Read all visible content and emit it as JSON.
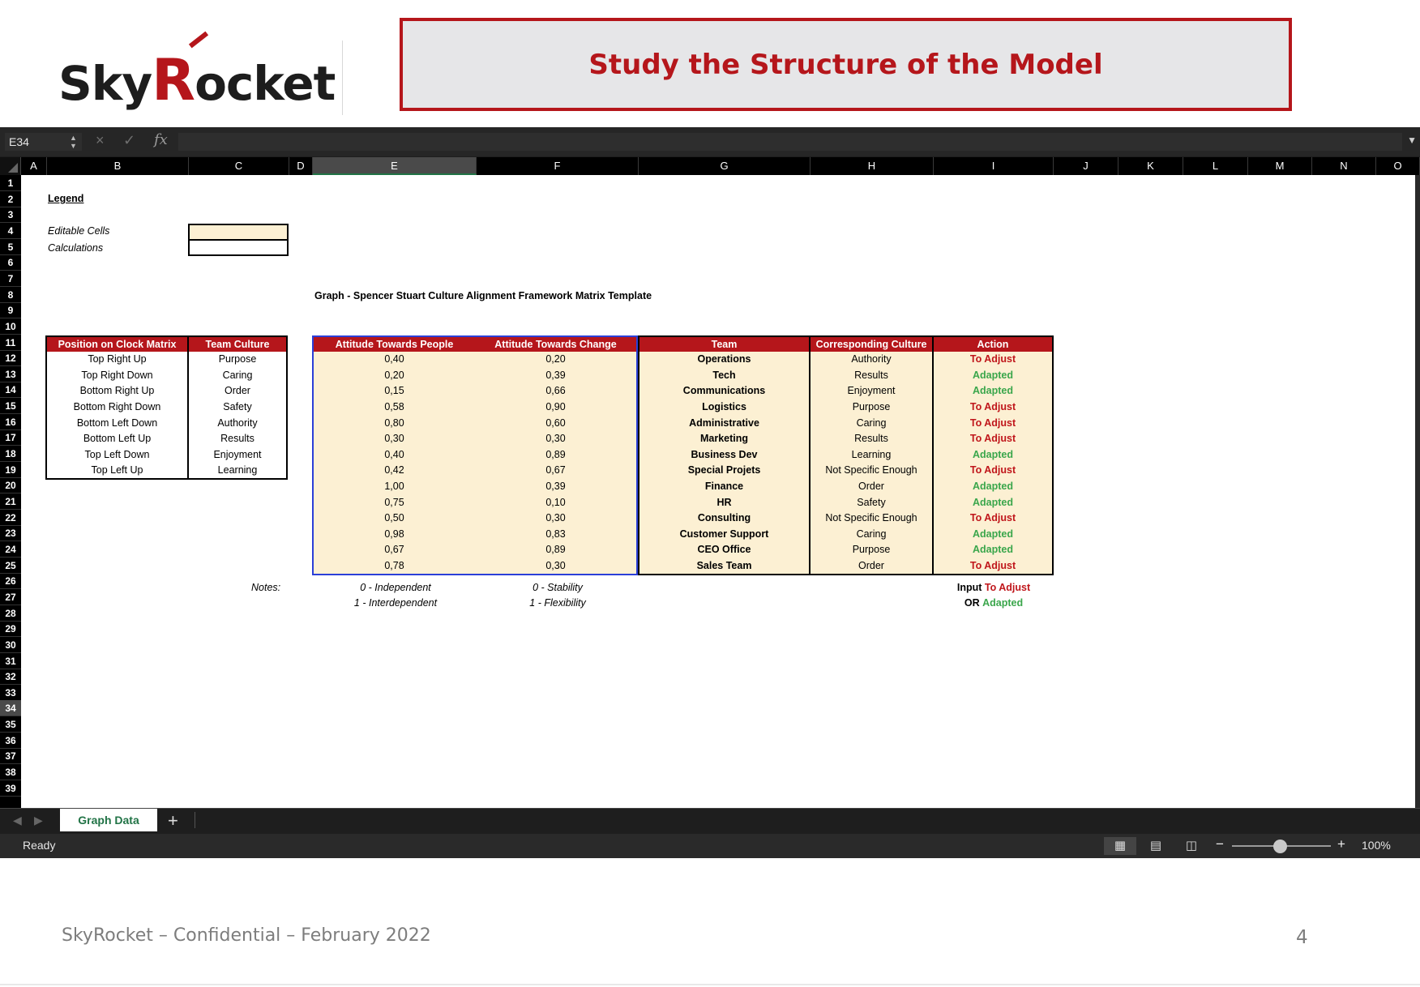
{
  "slide": {
    "logo": "SkyRocket",
    "title": "Study the Structure of the Model",
    "footer": "SkyRocket – Confidential – February 2022",
    "page_number": "4"
  },
  "formula_bar": {
    "name_box": "E34",
    "cancel_icon": "×",
    "confirm_icon": "✓",
    "fx_label": "fx",
    "value": ""
  },
  "columns": [
    "A",
    "B",
    "C",
    "D",
    "E",
    "F",
    "G",
    "H",
    "I",
    "J",
    "K",
    "L",
    "M",
    "N",
    "O"
  ],
  "selected_column": "E",
  "rows": [
    "1",
    "2",
    "3",
    "4",
    "5",
    "6",
    "7",
    "8",
    "9",
    "10",
    "11",
    "12",
    "13",
    "14",
    "15",
    "16",
    "17",
    "18",
    "19",
    "20",
    "21",
    "22",
    "23",
    "24",
    "25",
    "26",
    "27",
    "28",
    "29",
    "30",
    "31",
    "32",
    "33",
    "34",
    "35",
    "36",
    "37",
    "38",
    "39"
  ],
  "selected_row": "34",
  "legend": {
    "title": "Legend",
    "editable_label": "Editable Cells",
    "calculations_label": "Calculations",
    "editable_color": "#fcf0d3"
  },
  "graph_title": "Graph - Spencer Stuart Culture Alignment Framework Matrix Template",
  "clock_table": {
    "headers": [
      "Position on Clock Matrix",
      "Team Culture"
    ],
    "rows": [
      [
        "Top Right Up",
        "Purpose"
      ],
      [
        "Top Right Down",
        "Caring"
      ],
      [
        "Bottom Right Up",
        "Order"
      ],
      [
        "Bottom Right Down",
        "Safety"
      ],
      [
        "Bottom Left Down",
        "Authority"
      ],
      [
        "Bottom Left Up",
        "Results"
      ],
      [
        "Top Left Down",
        "Enjoyment"
      ],
      [
        "Top Left Up",
        "Learning"
      ]
    ]
  },
  "data_table": {
    "headers": [
      "Attitude Towards People",
      "Attitude Towards Change",
      "Team",
      "Corresponding Culture",
      "Action"
    ],
    "rows": [
      [
        "0,40",
        "0,20",
        "Operations",
        "Authority",
        "To Adjust"
      ],
      [
        "0,20",
        "0,39",
        "Tech",
        "Results",
        "Adapted"
      ],
      [
        "0,15",
        "0,66",
        "Communications",
        "Enjoyment",
        "Adapted"
      ],
      [
        "0,58",
        "0,90",
        "Logistics",
        "Purpose",
        "To Adjust"
      ],
      [
        "0,80",
        "0,60",
        "Administrative",
        "Caring",
        "To Adjust"
      ],
      [
        "0,30",
        "0,30",
        "Marketing",
        "Results",
        "To Adjust"
      ],
      [
        "0,40",
        "0,89",
        "Business Dev",
        "Learning",
        "Adapted"
      ],
      [
        "0,42",
        "0,67",
        "Special Projets",
        "Not Specific Enough",
        "To Adjust"
      ],
      [
        "1,00",
        "0,39",
        "Finance",
        "Order",
        "Adapted"
      ],
      [
        "0,75",
        "0,10",
        "HR",
        "Safety",
        "Adapted"
      ],
      [
        "0,50",
        "0,30",
        "Consulting",
        "Not Specific Enough",
        "To Adjust"
      ],
      [
        "0,98",
        "0,83",
        "Customer Support",
        "Caring",
        "Adapted"
      ],
      [
        "0,67",
        "0,89",
        "CEO Office",
        "Purpose",
        "Adapted"
      ],
      [
        "0,78",
        "0,30",
        "Sales Team",
        "Order",
        "To Adjust"
      ]
    ]
  },
  "notes": {
    "label": "Notes:",
    "people_0": "0 - Independent",
    "people_1": "1 - Interdependent",
    "change_0": "0 - Stability",
    "change_1": "1 - Flexibility",
    "input_prefix": "Input",
    "input_value": "To Adjust",
    "or_prefix": "OR",
    "or_value": "Adapted"
  },
  "sheet_tabs": [
    "Graph Data"
  ],
  "add_sheet": "+",
  "status": {
    "text": "Ready",
    "zoom_minus": "−",
    "zoom_plus": "+",
    "zoom": "100%",
    "zoom_level": 1.0
  },
  "colors": {
    "accent_red": "#b5161b",
    "to_adjust": "#c0161b",
    "adapted": "#3aa64b",
    "excel_green": "#217346"
  }
}
